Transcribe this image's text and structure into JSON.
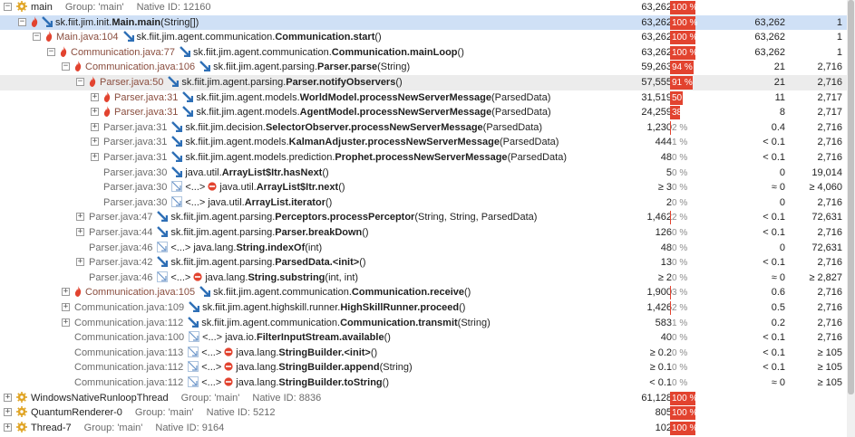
{
  "colors": {
    "hot": "#e2432f",
    "selected": "#cfe0f6",
    "blue_arrow": "#2e6fb6",
    "thread_gear": "#e0a526"
  },
  "rows": [
    {
      "depth": 0,
      "expander": "minus",
      "kind": "thread",
      "name": "main",
      "group": "Group: 'main'",
      "native": "Native ID: 12160",
      "time": "63,262",
      "pct": "100 %",
      "pct_frac": 1.0,
      "own": "",
      "count": ""
    },
    {
      "depth": 1,
      "expander": "minus",
      "kind": "hot-entry",
      "method_pre": "sk.fiit.jim.init.",
      "method_bold": "Main.main",
      "method_post": "(String[])",
      "time": "63,262",
      "pct": "100 %",
      "pct_frac": 1.0,
      "own": "63,262",
      "count": "1",
      "selected": true
    },
    {
      "depth": 2,
      "expander": "minus",
      "kind": "hot-call",
      "loc": "Main.java:104",
      "method_pre": "sk.fiit.jim.agent.communication.",
      "method_bold": "Communication.start",
      "method_post": "()",
      "time": "63,262",
      "pct": "100 %",
      "pct_frac": 1.0,
      "own": "63,262",
      "count": "1"
    },
    {
      "depth": 3,
      "expander": "minus",
      "kind": "hot-call",
      "loc": "Communication.java:77",
      "method_pre": "sk.fiit.jim.agent.communication.",
      "method_bold": "Communication.mainLoop",
      "method_post": "()",
      "time": "63,262",
      "pct": "100 %",
      "pct_frac": 1.0,
      "own": "63,262",
      "count": "1"
    },
    {
      "depth": 4,
      "expander": "minus",
      "kind": "hot-call",
      "loc": "Communication.java:106",
      "method_pre": "sk.fiit.jim.agent.parsing.",
      "method_bold": "Parser.parse",
      "method_post": "(String)",
      "time": "59,263",
      "pct": "94 %",
      "pct_frac": 0.94,
      "own": "21",
      "count": "2,716"
    },
    {
      "depth": 5,
      "expander": "minus",
      "kind": "hot-call",
      "loc": "Parser.java:50",
      "method_pre": "sk.fiit.jim.agent.parsing.",
      "method_bold": "Parser.notifyObservers",
      "method_post": "()",
      "time": "57,555",
      "pct": "91 %",
      "pct_frac": 0.91,
      "own": "21",
      "count": "2,716",
      "shaded": true
    },
    {
      "depth": 6,
      "expander": "plus",
      "kind": "hot-call",
      "loc": "Parser.java:31",
      "method_pre": "sk.fiit.jim.agent.models.",
      "method_bold": "WorldModel.processNewServerMessage",
      "method_post": "(ParsedData)",
      "time": "31,519",
      "pct": "50 %",
      "pct_frac": 0.5,
      "own": "11",
      "count": "2,717"
    },
    {
      "depth": 6,
      "expander": "plus",
      "kind": "hot-call",
      "loc": "Parser.java:31",
      "method_pre": "sk.fiit.jim.agent.models.",
      "method_bold": "AgentModel.processNewServerMessage",
      "method_post": "(ParsedData)",
      "time": "24,259",
      "pct": "38 %",
      "pct_frac": 0.38,
      "own": "8",
      "count": "2,717"
    },
    {
      "depth": 6,
      "expander": "plus",
      "kind": "call",
      "loc": "Parser.java:31",
      "method_pre": "sk.fiit.jim.decision.",
      "method_bold": "SelectorObserver.processNewServerMessage",
      "method_post": "(ParsedData)",
      "time": "1,230",
      "pct": "2 %",
      "pct_frac": 0.02,
      "own": "0.4",
      "count": "2,716"
    },
    {
      "depth": 6,
      "expander": "plus",
      "kind": "call",
      "loc": "Parser.java:31",
      "method_pre": "sk.fiit.jim.agent.models.",
      "method_bold": "KalmanAdjuster.processNewServerMessage",
      "method_post": "(ParsedData)",
      "time": "444",
      "pct": "1 %",
      "pct_frac": 0.01,
      "own": "< 0.1",
      "count": "2,716"
    },
    {
      "depth": 6,
      "expander": "plus",
      "kind": "call",
      "loc": "Parser.java:31",
      "method_pre": "sk.fiit.jim.agent.models.prediction.",
      "method_bold": "Prophet.processNewServerMessage",
      "method_post": "(ParsedData)",
      "time": "48",
      "pct": "0 %",
      "pct_frac": 0.0,
      "own": "< 0.1",
      "count": "2,716"
    },
    {
      "depth": 6,
      "expander": "none",
      "kind": "call",
      "loc": "Parser.java:30",
      "method_pre": "java.util.",
      "method_bold": "ArrayList$Itr.hasNext",
      "method_post": "()",
      "time": "5",
      "pct": "0 %",
      "pct_frac": 0.0,
      "own": "0",
      "count": "19,014"
    },
    {
      "depth": 6,
      "expander": "none",
      "kind": "lib-stop",
      "loc": "Parser.java:30",
      "lib": "<...>",
      "method_pre": "java.util.",
      "method_bold": "ArrayList$Itr.next",
      "method_post": "()",
      "time": "≥ 3",
      "pct": "0 %",
      "pct_frac": 0.0,
      "own": "≈ 0",
      "count": "≥ 4,060"
    },
    {
      "depth": 6,
      "expander": "none",
      "kind": "lib",
      "loc": "Parser.java:30",
      "lib": "<...>",
      "method_pre": "java.util.",
      "method_bold": "ArrayList.iterator",
      "method_post": "()",
      "time": "2",
      "pct": "0 %",
      "pct_frac": 0.0,
      "own": "0",
      "count": "2,716"
    },
    {
      "depth": 5,
      "expander": "plus",
      "kind": "call",
      "loc": "Parser.java:47",
      "method_pre": "sk.fiit.jim.agent.parsing.",
      "method_bold": "Perceptors.processPerceptor",
      "method_post": "(String, String, ParsedData)",
      "time": "1,462",
      "pct": "2 %",
      "pct_frac": 0.02,
      "own": "< 0.1",
      "count": "72,631"
    },
    {
      "depth": 5,
      "expander": "plus",
      "kind": "call",
      "loc": "Parser.java:44",
      "method_pre": "sk.fiit.jim.agent.parsing.",
      "method_bold": "Parser.breakDown",
      "method_post": "()",
      "time": "126",
      "pct": "0 %",
      "pct_frac": 0.0,
      "own": "< 0.1",
      "count": "2,716"
    },
    {
      "depth": 5,
      "expander": "none",
      "kind": "lib",
      "loc": "Parser.java:46",
      "lib": "<...>",
      "method_pre": "java.lang.",
      "method_bold": "String.indexOf",
      "method_post": "(int)",
      "time": "48",
      "pct": "0 %",
      "pct_frac": 0.0,
      "own": "0",
      "count": "72,631"
    },
    {
      "depth": 5,
      "expander": "plus",
      "kind": "call",
      "loc": "Parser.java:42",
      "method_pre": "sk.fiit.jim.agent.parsing.",
      "method_bold": "ParsedData.<init>",
      "method_post": "()",
      "time": "13",
      "pct": "0 %",
      "pct_frac": 0.0,
      "own": "< 0.1",
      "count": "2,716"
    },
    {
      "depth": 5,
      "expander": "none",
      "kind": "lib-stop",
      "loc": "Parser.java:46",
      "lib": "<...>",
      "method_pre": "java.lang.",
      "method_bold": "String.substring",
      "method_post": "(int, int)",
      "time": "≥ 2",
      "pct": "0 %",
      "pct_frac": 0.0,
      "own": "≈ 0",
      "count": "≥ 2,827"
    },
    {
      "depth": 4,
      "expander": "plus",
      "kind": "hot-call",
      "loc": "Communication.java:105",
      "method_pre": "sk.fiit.jim.agent.communication.",
      "method_bold": "Communication.receive",
      "method_post": "()",
      "time": "1,900",
      "pct": "3 %",
      "pct_frac": 0.03,
      "own": "0.6",
      "count": "2,716"
    },
    {
      "depth": 4,
      "expander": "plus",
      "kind": "call",
      "loc": "Communication.java:109",
      "method_pre": "sk.fiit.jim.agent.highskill.runner.",
      "method_bold": "HighSkillRunner.proceed",
      "method_post": "()",
      "time": "1,426",
      "pct": "2 %",
      "pct_frac": 0.02,
      "own": "0.5",
      "count": "2,716"
    },
    {
      "depth": 4,
      "expander": "plus",
      "kind": "call",
      "loc": "Communication.java:112",
      "method_pre": "sk.fiit.jim.agent.communication.",
      "method_bold": "Communication.transmit",
      "method_post": "(String)",
      "time": "583",
      "pct": "1 %",
      "pct_frac": 0.01,
      "own": "0.2",
      "count": "2,716"
    },
    {
      "depth": 4,
      "expander": "none",
      "kind": "lib",
      "loc": "Communication.java:100",
      "lib": "<...>",
      "method_pre": "java.io.",
      "method_bold": "FilterInputStream.available",
      "method_post": "()",
      "time": "40",
      "pct": "0 %",
      "pct_frac": 0.0,
      "own": "< 0.1",
      "count": "2,716"
    },
    {
      "depth": 4,
      "expander": "none",
      "kind": "lib-stop",
      "loc": "Communication.java:113",
      "lib": "<...>",
      "method_pre": "java.lang.",
      "method_bold": "StringBuilder.<init>",
      "method_post": "()",
      "time": "≥ 0.2",
      "pct": "0 %",
      "pct_frac": 0.0,
      "own": "< 0.1",
      "count": "≥ 105"
    },
    {
      "depth": 4,
      "expander": "none",
      "kind": "lib-stop",
      "loc": "Communication.java:112",
      "lib": "<...>",
      "method_pre": "java.lang.",
      "method_bold": "StringBuilder.append",
      "method_post": "(String)",
      "time": "≥ 0.1",
      "pct": "0 %",
      "pct_frac": 0.0,
      "own": "< 0.1",
      "count": "≥ 105"
    },
    {
      "depth": 4,
      "expander": "none",
      "kind": "lib-stop",
      "loc": "Communication.java:112",
      "lib": "<...>",
      "method_pre": "java.lang.",
      "method_bold": "StringBuilder.toString",
      "method_post": "()",
      "time": "< 0.1",
      "pct": "0 %",
      "pct_frac": 0.0,
      "own": "≈ 0",
      "count": "≥ 105"
    },
    {
      "depth": 0,
      "expander": "plus",
      "kind": "thread",
      "name": "WindowsNativeRunloopThread",
      "group": "Group: 'main'",
      "native": "Native ID: 8836",
      "time": "61,128",
      "pct": "100 %",
      "pct_frac": 1.0,
      "own": "",
      "count": ""
    },
    {
      "depth": 0,
      "expander": "plus",
      "kind": "thread",
      "name": "QuantumRenderer-0",
      "group": "Group: 'main'",
      "native": "Native ID: 5212",
      "time": "805",
      "pct": "100 %",
      "pct_frac": 1.0,
      "own": "",
      "count": ""
    },
    {
      "depth": 0,
      "expander": "plus",
      "kind": "thread",
      "name": "Thread-7",
      "group": "Group: 'main'",
      "native": "Native ID: 9164",
      "time": "102",
      "pct": "100 %",
      "pct_frac": 1.0,
      "own": "",
      "count": ""
    }
  ]
}
